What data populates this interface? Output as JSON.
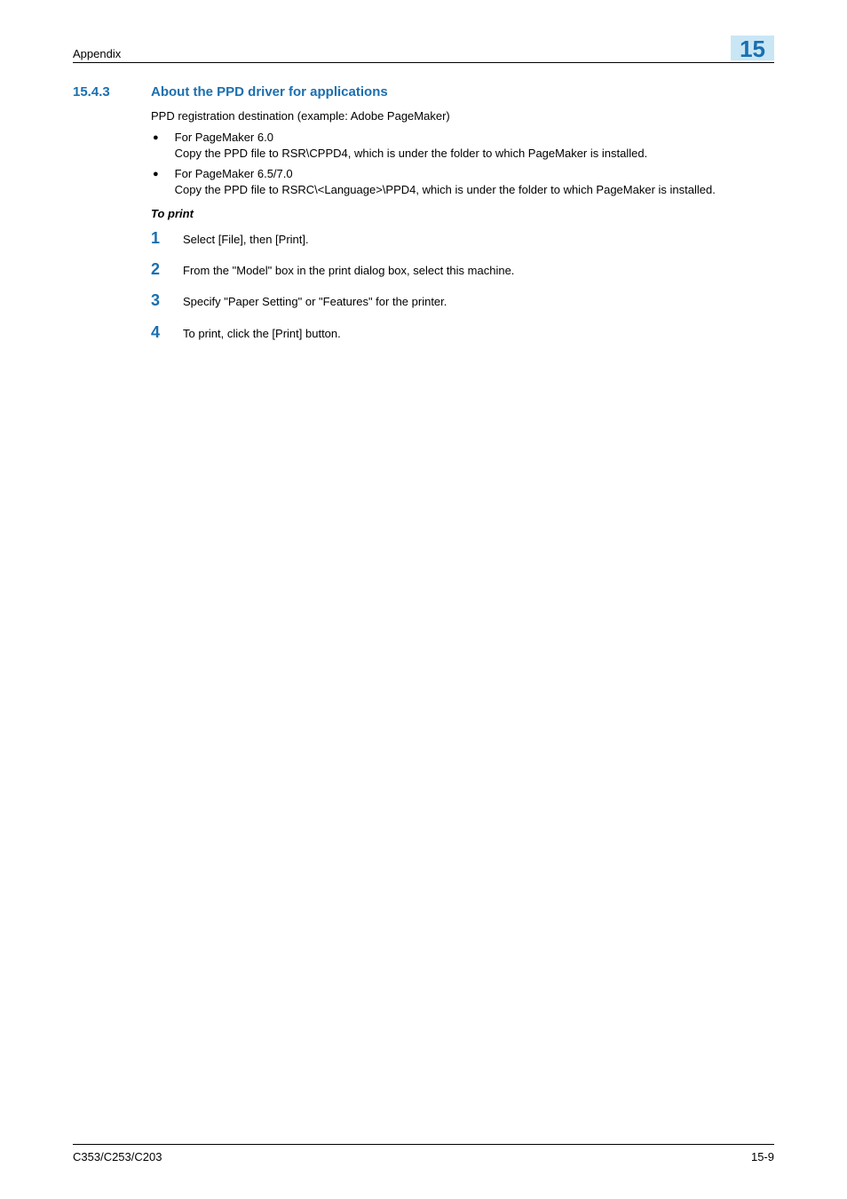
{
  "header": {
    "left": "Appendix",
    "right": "15"
  },
  "section": {
    "number": "15.4.3",
    "title": "About the PPD driver for applications",
    "intro": "PPD registration destination (example: Adobe PageMaker)"
  },
  "bullets": [
    {
      "title": "For PageMaker 6.0",
      "body": "Copy the PPD file to RSR\\CPPD4, which is under the folder to which PageMaker is installed."
    },
    {
      "title": "For PageMaker 6.5/7.0",
      "body": "Copy the PPD file to RSRC\\<Language>\\PPD4, which is under the folder to which PageMaker is installed."
    }
  ],
  "subheading": "To print",
  "steps": [
    {
      "n": "1",
      "text": "Select [File], then [Print]."
    },
    {
      "n": "2",
      "text": "From the \"Model\" box in the print dialog box, select this machine."
    },
    {
      "n": "3",
      "text": "Specify \"Paper Setting\" or \"Features\" for the printer."
    },
    {
      "n": "4",
      "text": "To print, click the [Print] button."
    }
  ],
  "footer": {
    "left": "C353/C253/C203",
    "right": "15-9"
  }
}
